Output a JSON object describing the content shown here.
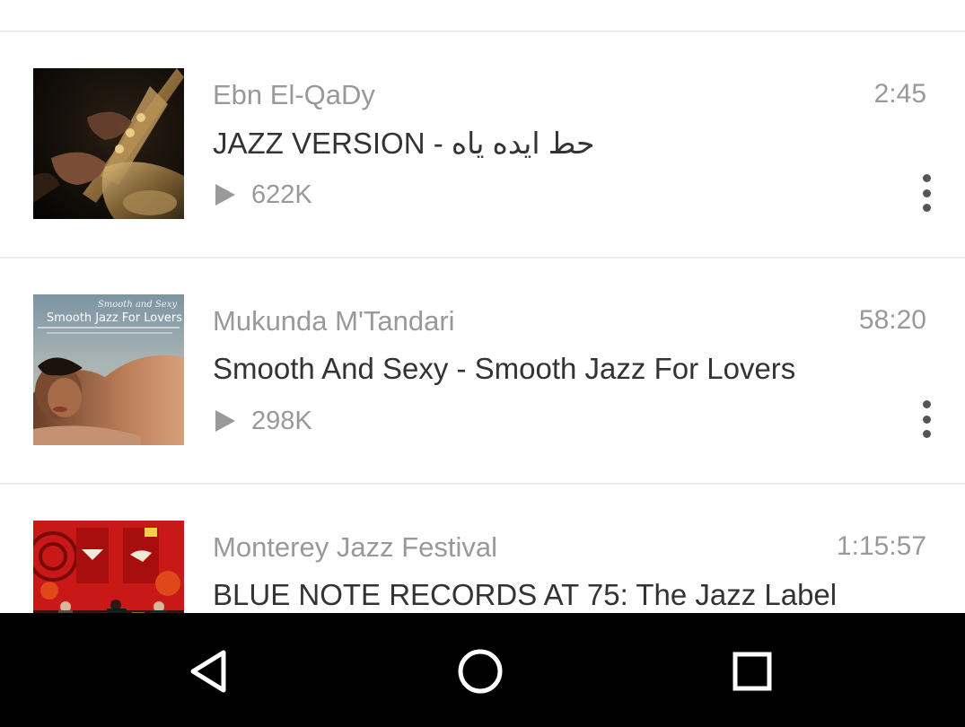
{
  "tracks": [
    {
      "artist": "Ebn El-QaDy",
      "title": "JAZZ VERSION - حط ايده ياه",
      "duration": "2:45",
      "plays": "622K",
      "artwork": "saxophone-artwork"
    },
    {
      "artist": "Mukunda M'Tandari",
      "title": "Smooth And Sexy - Smooth Jazz For Lovers",
      "duration": "58:20",
      "plays": "298K",
      "artwork": "smooth-jazz-artwork",
      "artwork_text": {
        "script": "Smooth and Sexy",
        "caption": "Smooth Jazz For Lovers"
      }
    },
    {
      "artist": "Monterey Jazz Festival",
      "title": "BLUE NOTE RECORDS AT 75: The Jazz Label",
      "duration": "1:15:57",
      "artwork": "festival-stage-artwork"
    }
  ],
  "icons": {
    "play": "play-icon",
    "more": "more-vert-icon",
    "nav_back": "back-triangle-icon",
    "nav_home": "home-circle-icon",
    "nav_recents": "recents-square-icon"
  },
  "colors": {
    "secondary_text": "#999999",
    "primary_text": "#333333",
    "nav_bar": "#000000"
  }
}
